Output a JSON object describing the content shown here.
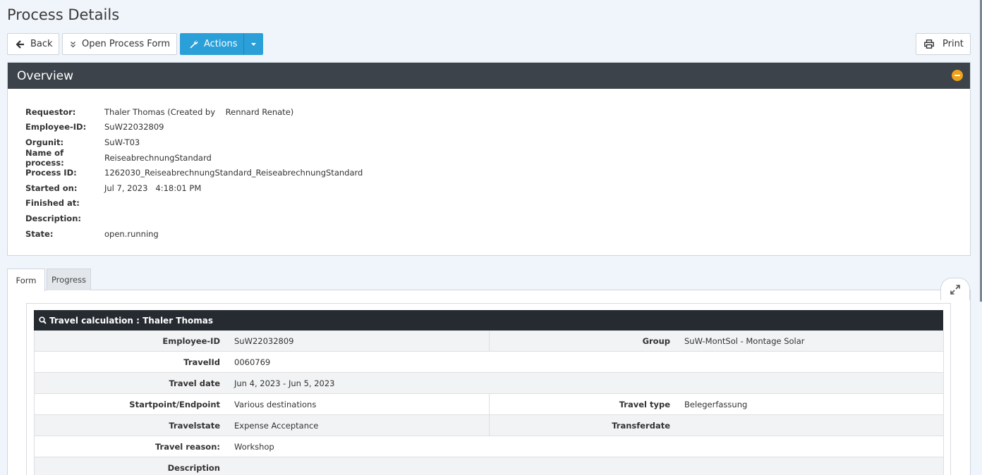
{
  "page": {
    "title": "Process Details"
  },
  "toolbar": {
    "back_label": "Back",
    "open_form_label": "Open Process Form",
    "actions_label": "Actions",
    "print_label": "Print"
  },
  "overview": {
    "title": "Overview",
    "rows": [
      {
        "label": "Requestor:",
        "value": "Thaler Thomas (Created by    Rennard Renate)"
      },
      {
        "label": "Employee-ID:",
        "value": "SuW22032809"
      },
      {
        "label": "Orgunit:",
        "value": "SuW-T03"
      },
      {
        "label": "Name of process:",
        "value": "ReiseabrechnungStandard"
      },
      {
        "label": "Process ID:",
        "value": "1262030_ReiseabrechnungStandard_ReiseabrechnungStandard"
      },
      {
        "label": "Started on:",
        "value": "Jul 7, 2023   4:18:01 PM"
      },
      {
        "label": "Finished at:",
        "value": ""
      },
      {
        "label": "Description:",
        "value": ""
      },
      {
        "label": "State:",
        "value": "open.running"
      }
    ]
  },
  "tabs": [
    {
      "label": "Form",
      "active": true
    },
    {
      "label": "Progress",
      "active": false
    }
  ],
  "travel_calc": {
    "title": "Travel calculation : Thaler Thomas",
    "rows": [
      {
        "label": "Employee-ID",
        "value": "SuW22032809",
        "right_label": "Group",
        "right_value": "SuW-MontSol - Montage Solar"
      },
      {
        "label": "TravelId",
        "value": "0060769"
      },
      {
        "label": "Travel date",
        "value": "Jun 4, 2023 - Jun 5, 2023"
      },
      {
        "label": "Startpoint/Endpoint",
        "value": "Various destinations",
        "right_label": "Travel type",
        "right_value": "Belegerfassung"
      },
      {
        "label": "Travelstate",
        "value": "Expense Acceptance",
        "right_label": "Transferdate",
        "right_value": ""
      },
      {
        "label": "Travel reason:",
        "value": "Workshop"
      },
      {
        "label": "Description",
        "value": ""
      }
    ]
  },
  "colors": {
    "accent": "#2a9fd8",
    "header_dark": "#3c434b",
    "collapse_orange": "#f0a21b"
  }
}
